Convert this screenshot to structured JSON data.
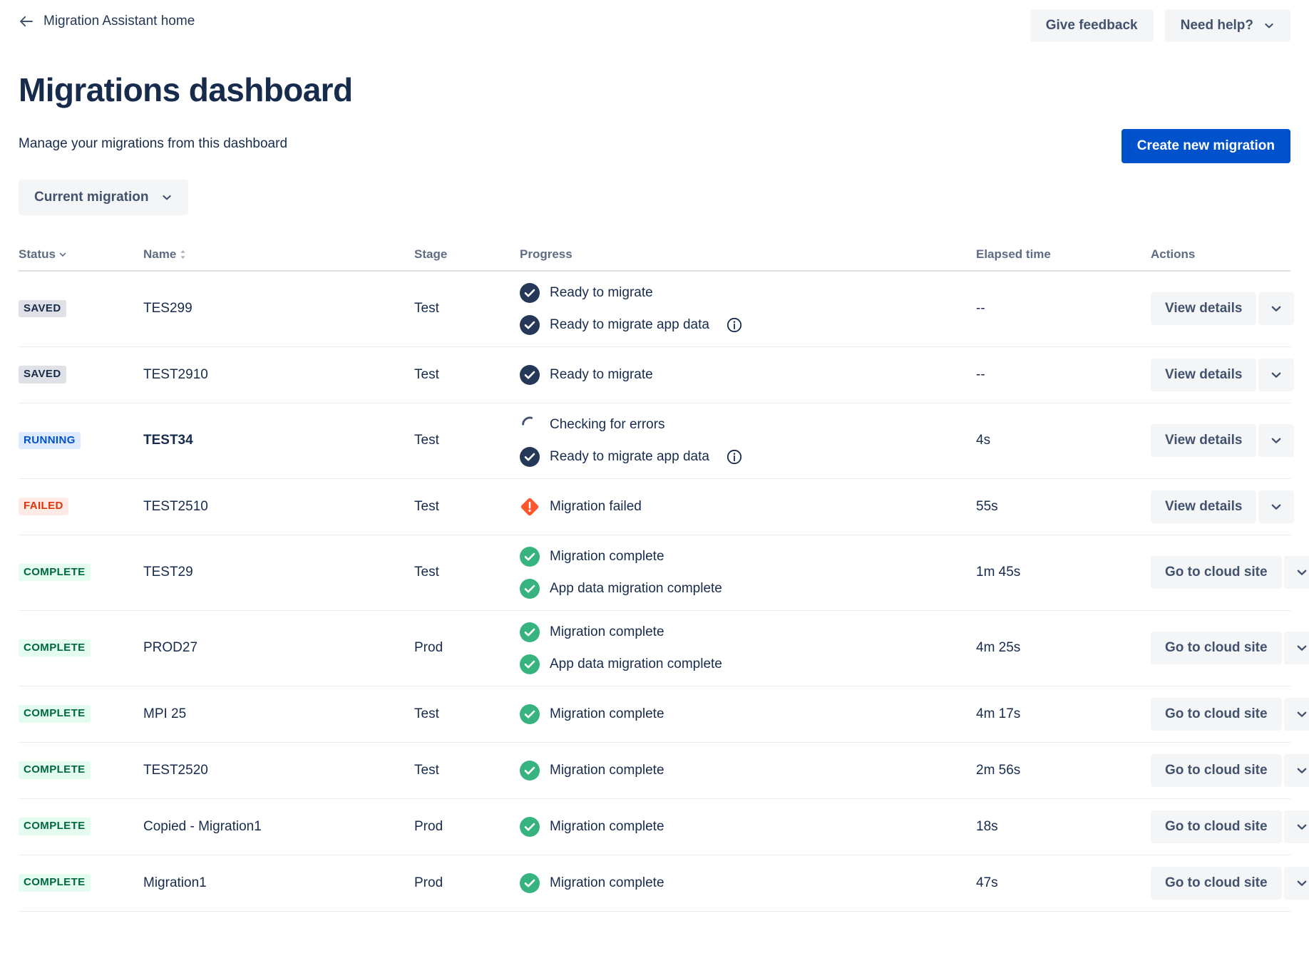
{
  "header": {
    "breadcrumb_label": "Migration Assistant home",
    "back_icon": "arrow-left-icon",
    "give_feedback_label": "Give feedback",
    "need_help_label": "Need help?",
    "need_help_icon": "chevron-down-icon"
  },
  "title": "Migrations dashboard",
  "subtitle": "Manage your migrations from this dashboard",
  "create_button_label": "Create new migration",
  "filter": {
    "label": "Current migration",
    "icon": "chevron-down-icon"
  },
  "table": {
    "columns": {
      "status": "Status",
      "name": "Name",
      "stage": "Stage",
      "progress": "Progress",
      "elapsed": "Elapsed time",
      "actions": "Actions"
    },
    "sort": {
      "status_icon": "chevron-down-icon",
      "name_icon": "sort-updown-icon"
    },
    "rows": [
      {
        "status": "SAVED",
        "status_type": "saved",
        "name": "TES299",
        "name_bold": false,
        "stage": "Test",
        "progress": [
          {
            "icon": "check-circle-navy-icon",
            "label": "Ready to migrate",
            "info": false
          },
          {
            "icon": "check-circle-navy-icon",
            "label": "Ready to migrate app data",
            "info": true
          }
        ],
        "elapsed": "--",
        "action_label": "View details",
        "action_menu_icon": "chevron-down-icon"
      },
      {
        "status": "SAVED",
        "status_type": "saved",
        "name": "TEST2910",
        "name_bold": false,
        "stage": "Test",
        "progress": [
          {
            "icon": "check-circle-navy-icon",
            "label": "Ready to migrate",
            "info": false
          }
        ],
        "elapsed": "--",
        "action_label": "View details",
        "action_menu_icon": "chevron-down-icon"
      },
      {
        "status": "RUNNING",
        "status_type": "running",
        "name": "TEST34",
        "name_bold": true,
        "stage": "Test",
        "progress": [
          {
            "icon": "spinner-icon",
            "label": "Checking for errors",
            "info": false
          },
          {
            "icon": "check-circle-navy-icon",
            "label": "Ready to migrate app data",
            "info": true
          }
        ],
        "elapsed": "4s",
        "action_label": "View details",
        "action_menu_icon": "chevron-down-icon"
      },
      {
        "status": "FAILED",
        "status_type": "failed",
        "name": "TEST2510",
        "name_bold": false,
        "stage": "Test",
        "progress": [
          {
            "icon": "error-diamond-icon",
            "label": "Migration failed",
            "info": false
          }
        ],
        "elapsed": "55s",
        "action_label": "View details",
        "action_menu_icon": "chevron-down-icon"
      },
      {
        "status": "COMPLETE",
        "status_type": "complete",
        "name": "TEST29",
        "name_bold": false,
        "stage": "Test",
        "progress": [
          {
            "icon": "check-circle-green-icon",
            "label": "Migration complete",
            "info": false
          },
          {
            "icon": "check-circle-green-icon",
            "label": "App data migration complete",
            "info": false
          }
        ],
        "elapsed": "1m 45s",
        "action_label": "Go to cloud site",
        "action_menu_icon": "chevron-down-icon"
      },
      {
        "status": "COMPLETE",
        "status_type": "complete",
        "name": "PROD27",
        "name_bold": false,
        "stage": "Prod",
        "progress": [
          {
            "icon": "check-circle-green-icon",
            "label": "Migration complete",
            "info": false
          },
          {
            "icon": "check-circle-green-icon",
            "label": "App data migration complete",
            "info": false
          }
        ],
        "elapsed": "4m 25s",
        "action_label": "Go to cloud site",
        "action_menu_icon": "chevron-down-icon"
      },
      {
        "status": "COMPLETE",
        "status_type": "complete",
        "name": "MPI 25",
        "name_bold": false,
        "stage": "Test",
        "progress": [
          {
            "icon": "check-circle-green-icon",
            "label": "Migration complete",
            "info": false
          }
        ],
        "elapsed": "4m 17s",
        "action_label": "Go to cloud site",
        "action_menu_icon": "chevron-down-icon"
      },
      {
        "status": "COMPLETE",
        "status_type": "complete",
        "name": "TEST2520",
        "name_bold": false,
        "stage": "Test",
        "progress": [
          {
            "icon": "check-circle-green-icon",
            "label": "Migration complete",
            "info": false
          }
        ],
        "elapsed": "2m 56s",
        "action_label": "Go to cloud site",
        "action_menu_icon": "chevron-down-icon"
      },
      {
        "status": "COMPLETE",
        "status_type": "complete",
        "name": "Copied - Migration1",
        "name_bold": false,
        "stage": "Prod",
        "progress": [
          {
            "icon": "check-circle-green-icon",
            "label": "Migration complete",
            "info": false
          }
        ],
        "elapsed": "18s",
        "action_label": "Go to cloud site",
        "action_menu_icon": "chevron-down-icon"
      },
      {
        "status": "COMPLETE",
        "status_type": "complete",
        "name": "Migration1",
        "name_bold": false,
        "stage": "Prod",
        "progress": [
          {
            "icon": "check-circle-green-icon",
            "label": "Migration complete",
            "info": false
          }
        ],
        "elapsed": "47s",
        "action_label": "Go to cloud site",
        "action_menu_icon": "chevron-down-icon"
      }
    ]
  },
  "colors": {
    "primary": "#0052CC",
    "text": "#172B4D",
    "subtle_text": "#5E6C84",
    "navy_icon": "#253858",
    "green": "#36B37E",
    "green_text": "#006644",
    "red": "#FF5630",
    "red_text": "#DE350B",
    "button_bg": "#F4F5F7",
    "border": "#EBECF0"
  }
}
